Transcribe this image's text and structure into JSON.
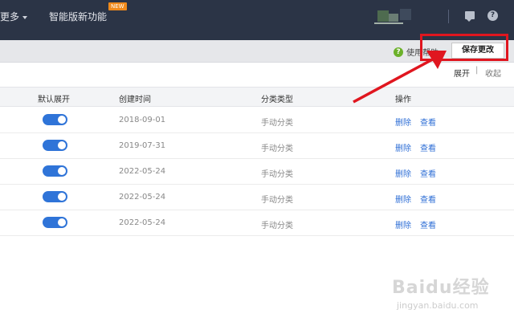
{
  "topnav": {
    "more_label": "更多",
    "smart_label": "智能版新功能",
    "new_badge": "NEW"
  },
  "toolbar": {
    "help_label": "使用帮助",
    "save_label": "保存更改"
  },
  "view": {
    "expand_label": "展开",
    "separator": "|",
    "collapse_label": "收起"
  },
  "table": {
    "headers": [
      "默认展开",
      "创建时间",
      "分类类型",
      "操作"
    ],
    "rows": [
      {
        "default_expand": true,
        "created": "2018-09-01",
        "type": "手动分类",
        "delete": "删除",
        "view": "查看"
      },
      {
        "default_expand": true,
        "created": "2019-07-31",
        "type": "手动分类",
        "delete": "删除",
        "view": "查看"
      },
      {
        "default_expand": true,
        "created": "2022-05-24",
        "type": "手动分类",
        "delete": "删除",
        "view": "查看"
      },
      {
        "default_expand": true,
        "created": "2022-05-24",
        "type": "手动分类",
        "delete": "删除",
        "view": "查看"
      },
      {
        "default_expand": true,
        "created": "2022-05-24",
        "type": "手动分类",
        "delete": "删除",
        "view": "查看"
      }
    ]
  },
  "icons": {
    "message": "message-icon",
    "help": "help-icon"
  },
  "colors": {
    "topbar": "#2b3446",
    "toggle_on": "#2f74d8",
    "link": "#2f6fd6",
    "highlight": "#e0161f",
    "badge": "#f08a1b"
  },
  "watermark": {
    "brand": "Baidu经验",
    "url": "jingyan.baidu.com"
  }
}
